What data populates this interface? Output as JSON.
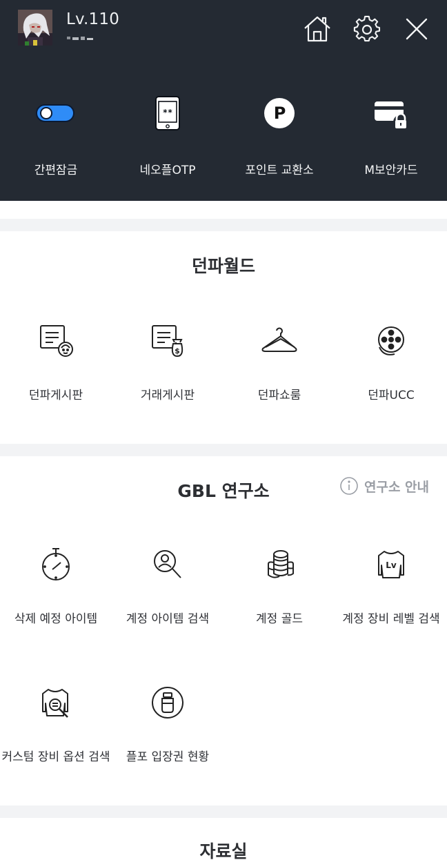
{
  "header": {
    "level_text": "Lv.110",
    "icons": {
      "home": "home-icon",
      "settings": "gear-icon",
      "close": "close-icon"
    }
  },
  "quick_menu": [
    {
      "label": "간편잠금",
      "icon": "toggle-switch-icon"
    },
    {
      "label": "네오플OTP",
      "icon": "otp-phone-icon"
    },
    {
      "label": "포인트 교환소",
      "icon": "point-p-icon"
    },
    {
      "label": "M보안카드",
      "icon": "security-card-icon"
    }
  ],
  "dunpa_world": {
    "title": "던파월드",
    "items": [
      {
        "label": "던파게시판",
        "icon": "board-icon"
      },
      {
        "label": "거래게시판",
        "icon": "trade-board-icon"
      },
      {
        "label": "던파쇼룸",
        "icon": "hanger-icon"
      },
      {
        "label": "던파UCC",
        "icon": "film-reel-icon"
      }
    ]
  },
  "gbl_lab": {
    "title": "GBL 연구소",
    "guide_label": "연구소 안내",
    "items": [
      {
        "label": "삭제 예정 아이템",
        "icon": "stopwatch-icon"
      },
      {
        "label": "계정 아이템 검색",
        "icon": "search-person-icon"
      },
      {
        "label": "계정 골드",
        "icon": "coin-stack-icon"
      },
      {
        "label": "계정 장비 레벨 검색",
        "icon": "lv-shirt-icon"
      },
      {
        "label": "커스텀 장비 옵션 검색",
        "icon": "shirt-search-icon"
      },
      {
        "label": "플포 입장권 현황",
        "icon": "bottle-icon"
      }
    ]
  },
  "archive": {
    "title": "자료실"
  },
  "colors": {
    "header_bg": "#242a33",
    "toggle_blue": "#2f8cf7",
    "separator": "#f2f3f5"
  }
}
